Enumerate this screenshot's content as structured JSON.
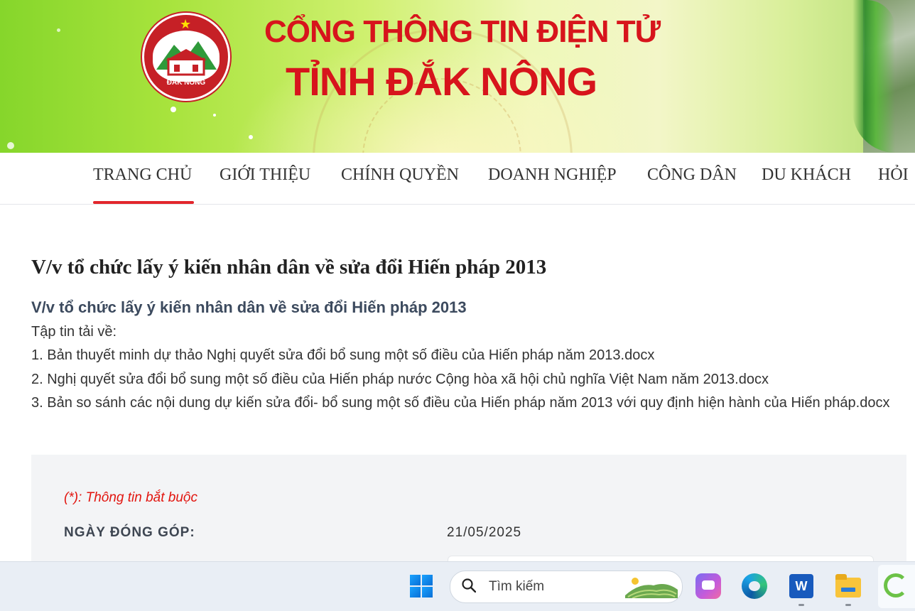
{
  "banner": {
    "title_line1": "CỔNG THÔNG TIN ĐIỆN TỬ",
    "title_line2": "TỈNH ĐẮK NÔNG",
    "logo_text": "ĐẮK NÔNG",
    "title_color": "#d7141c"
  },
  "nav": {
    "items": [
      {
        "label": "TRANG CHỦ",
        "active": true
      },
      {
        "label": "GIỚI THIỆU"
      },
      {
        "label": "CHÍNH QUYỀN"
      },
      {
        "label": "DOANH NGHIỆP"
      },
      {
        "label": "CÔNG DÂN"
      },
      {
        "label": "DU KHÁCH"
      },
      {
        "label": "HỎI"
      }
    ],
    "active_color": "#e2262c"
  },
  "article": {
    "title": "V/v tổ chức lấy ý kiến nhân dân về sửa đổi Hiến pháp 2013",
    "subtitle": "V/v tổ chức lấy ý kiến nhân dân về sửa đổi Hiến pháp 2013",
    "downloads_label": "Tập tin tải về:",
    "files": [
      "1. Bản thuyết minh dự thảo Nghị quyết sửa đổi bổ sung một số điều của Hiến pháp năm 2013.docx",
      "2. Nghị quyết sửa đổi bổ sung một số điều của Hiến pháp nước Cộng hòa xã hội chủ nghĩa Việt Nam năm 2013.docx",
      "3. Bản so sánh các nội dung dự kiến sửa đổi- bổ sung một số điều của Hiến pháp năm 2013 với quy định hiện hành của Hiến pháp.docx"
    ]
  },
  "form": {
    "required_note": "(*): Thông tin bắt buộc",
    "date_label": "NGÀY ĐÓNG GÓP:",
    "date_value": "21/05/2025"
  },
  "taskbar": {
    "search_placeholder": "Tìm kiếm",
    "word_letter": "W",
    "apps": [
      "start-icon",
      "copilot-icon",
      "edge-icon",
      "word-icon",
      "file-explorer-icon",
      "app-icon"
    ]
  }
}
